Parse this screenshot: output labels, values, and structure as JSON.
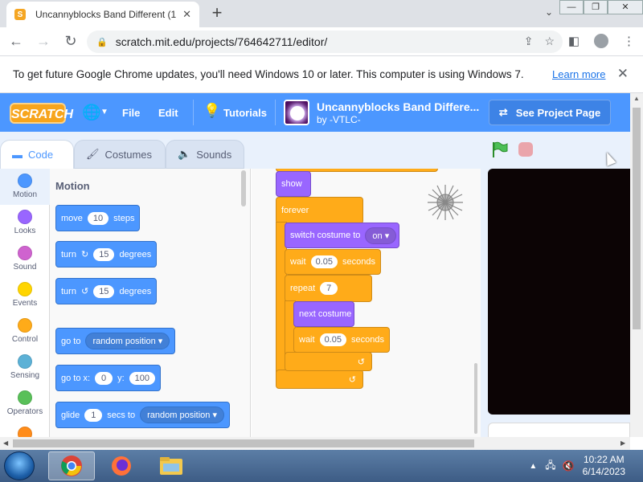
{
  "browser": {
    "tab_title": "Uncannyblocks Band Different (1",
    "favicon_letter": "S",
    "url": "scratch.mit.edu/projects/764642711/editor/",
    "infobar_text": "To get future Google Chrome updates, you'll need Windows 10 or later. This computer is using Windows 7.",
    "infobar_link": "Learn more"
  },
  "scratch": {
    "logo": "SCRATCH",
    "menu": {
      "file": "File",
      "edit": "Edit",
      "tutorials": "Tutorials"
    },
    "project_title": "Uncannyblocks Band Differe...",
    "project_author": "by -VTLC-",
    "see_project": "See Project Page",
    "tabs": {
      "code": "Code",
      "costumes": "Costumes",
      "sounds": "Sounds"
    },
    "categories": [
      {
        "label": "Motion",
        "color": "#4c97ff"
      },
      {
        "label": "Looks",
        "color": "#9966ff"
      },
      {
        "label": "Sound",
        "color": "#cf63cf"
      },
      {
        "label": "Events",
        "color": "#ffd500"
      },
      {
        "label": "Control",
        "color": "#ffab19"
      },
      {
        "label": "Sensing",
        "color": "#5cb1d6"
      },
      {
        "label": "Operators",
        "color": "#59c059"
      }
    ],
    "palette": {
      "heading": "Motion",
      "move": {
        "a": "move",
        "v": "10",
        "b": "steps"
      },
      "turn_right": {
        "a": "turn",
        "v": "15",
        "b": "degrees"
      },
      "turn_left": {
        "a": "turn",
        "v": "15",
        "b": "degrees"
      },
      "goto": {
        "a": "go to",
        "dd": "random position"
      },
      "gotoxy": {
        "a": "go to x:",
        "x": "0",
        "b": "y:",
        "y": "100"
      },
      "glide": {
        "a": "glide",
        "v": "1",
        "b": "secs to",
        "dd": "random position"
      }
    },
    "script": {
      "show": "show",
      "forever": "forever",
      "switch_costume": {
        "a": "switch costume to",
        "dd": "on"
      },
      "wait1": {
        "a": "wait",
        "v": "0.05",
        "b": "seconds"
      },
      "repeat": {
        "a": "repeat",
        "v": "7"
      },
      "next_costume": "next costume",
      "wait2": {
        "a": "wait",
        "v": "0.05",
        "b": "seconds"
      }
    }
  },
  "taskbar": {
    "time": "10:22 AM",
    "date": "6/14/2023"
  }
}
